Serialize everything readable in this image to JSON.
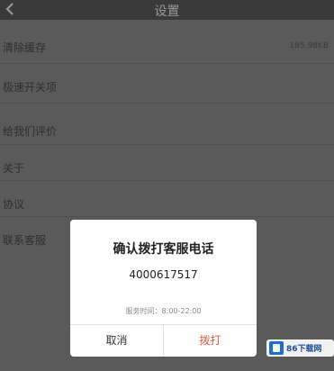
{
  "header": {
    "title": "设置"
  },
  "settings": {
    "items": [
      {
        "label": "清除缓存",
        "value": "185.98KB"
      },
      {
        "label": "极速开关项",
        "value": ""
      },
      {
        "label": "给我们评价",
        "value": ""
      },
      {
        "label": "关于",
        "value": ""
      },
      {
        "label": "协议",
        "value": ""
      },
      {
        "label": "联系客服",
        "value": ""
      }
    ]
  },
  "dialog": {
    "title": "确认拨打客服电话",
    "phone": "4000617517",
    "hours": "服务时间：8:00-22:00",
    "cancel_label": "取消",
    "call_label": "拨打"
  },
  "watermark": {
    "text": "86下载网"
  },
  "colors": {
    "accent": "#e2563f",
    "overlay": "#555555",
    "brand": "#1c6fd4"
  },
  "icons": {
    "back": "back-arrow-icon",
    "watermark_logo": "site-logo-icon"
  }
}
